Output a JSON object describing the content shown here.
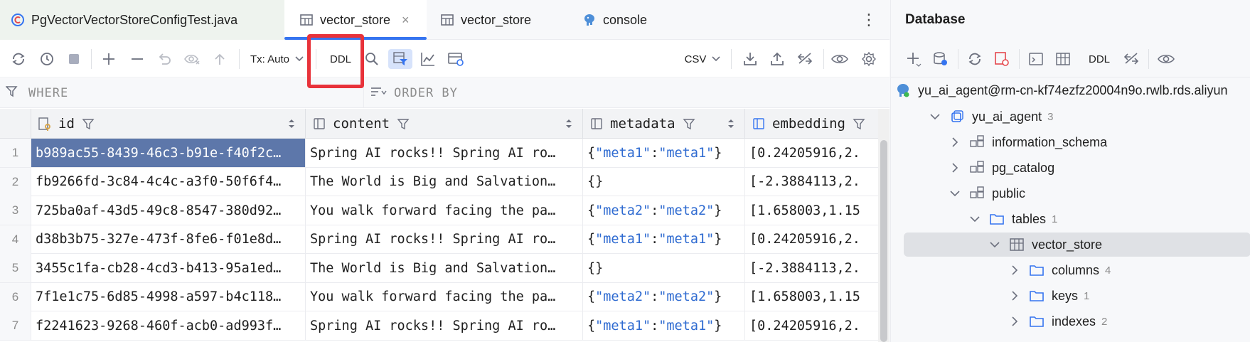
{
  "tabs": [
    {
      "label": "PgVectorVectorStoreConfigTest.java",
      "icon": "java-class-icon"
    },
    {
      "label": "vector_store",
      "icon": "table-icon",
      "active": true,
      "close": "×"
    },
    {
      "label": "vector_store",
      "icon": "table-icon"
    },
    {
      "label": "console",
      "icon": "postgres-icon"
    }
  ],
  "toolbar": {
    "tx_mode": "Tx: Auto",
    "ddl_label": "DDL",
    "export_format": "CSV"
  },
  "filter": {
    "where_label": "WHERE",
    "orderby_label": "ORDER BY"
  },
  "columns": [
    "id",
    "content",
    "metadata",
    "embedding"
  ],
  "rows": [
    {
      "num": "1",
      "id": "b989ac55-8439-46c3-b91e-f40f2c…",
      "content": "Spring AI rocks!! Spring AI ro…",
      "metadata": {
        "k": "meta1",
        "v": "meta1"
      },
      "embedding": "[0.24205916,2."
    },
    {
      "num": "2",
      "id": "fb9266fd-3c84-4c4c-a3f0-50f6f4…",
      "content": "The World is Big and Salvation…",
      "metadata": {
        "raw": "{}"
      },
      "embedding": "[-2.3884113,2."
    },
    {
      "num": "3",
      "id": "725ba0af-43d5-49c8-8547-380d92…",
      "content": "You walk forward facing the pa…",
      "metadata": {
        "k": "meta2",
        "v": "meta2"
      },
      "embedding": "[1.658003,1.15"
    },
    {
      "num": "4",
      "id": "d38b3b75-327e-473f-8fe6-f01e8d…",
      "content": "Spring AI rocks!! Spring AI ro…",
      "metadata": {
        "k": "meta1",
        "v": "meta1"
      },
      "embedding": "[0.24205916,2."
    },
    {
      "num": "5",
      "id": "3455c1fa-cb28-4cd3-b413-95a1ed…",
      "content": "The World is Big and Salvation…",
      "metadata": {
        "raw": "{}"
      },
      "embedding": "[-2.3884113,2."
    },
    {
      "num": "6",
      "id": "7f1e1c75-6d85-4998-a597-b4c118…",
      "content": "You walk forward facing the pa…",
      "metadata": {
        "k": "meta2",
        "v": "meta2"
      },
      "embedding": "[1.658003,1.15"
    },
    {
      "num": "7",
      "id": "f2241623-9268-460f-acb0-ad993f…",
      "content": "Spring AI rocks!! Spring AI ro…",
      "metadata": {
        "k": "meta1",
        "v": "meta1"
      },
      "embedding": "[0.24205916,2."
    }
  ],
  "database": {
    "title": "Database",
    "ddl_label": "DDL",
    "tree": {
      "connection": "yu_ai_agent@rm-cn-kf74ezfz20004n9o.rwlb.rds.aliyun",
      "database": {
        "label": "yu_ai_agent",
        "count": "3"
      },
      "schemas": [
        "information_schema",
        "pg_catalog",
        "public"
      ],
      "tables": {
        "label": "tables",
        "count": "1"
      },
      "table": "vector_store",
      "children": [
        {
          "label": "columns",
          "count": "4"
        },
        {
          "label": "keys",
          "count": "1"
        },
        {
          "label": "indexes",
          "count": "2"
        }
      ]
    }
  },
  "colors": {
    "accent": "#3574f0",
    "selection": "#5d77aa",
    "highlight_box": "#e8323a",
    "json_key": "#2f6bd1"
  }
}
